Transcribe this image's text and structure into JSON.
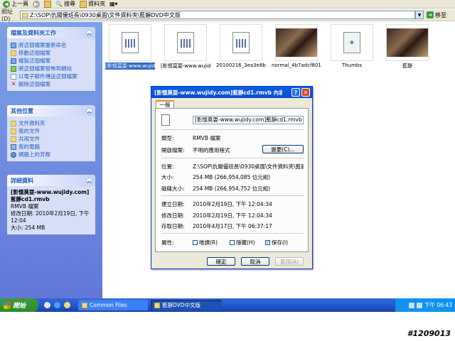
{
  "toolbar": {
    "back": "上一頁",
    "search": "搜尋",
    "folders": "資料夾"
  },
  "address": {
    "label": "網址(D)",
    "path": "Z:\\SOP\\仇關優班長\\0930桌面\\文件資料夾\\藍靜DVD中文版",
    "go": "移至"
  },
  "tasks": {
    "file_header": "檔案及資料夾工作",
    "file_items": [
      "將這個檔案重新命名",
      "移動這個檔案",
      "複製這個檔案",
      "將這個檔案發佈到網站",
      "以電子郵件傳送這個檔案",
      "刪除這個檔案"
    ],
    "places_header": "其他位置",
    "places_items": [
      "文件資料夾",
      "我的文件",
      "共用文件",
      "我的電腦",
      "網路上的芳鄰"
    ],
    "details_header": "詳細資料",
    "details_name": "[影憶莫耍-www.wujidy.com]藍靜cd1.rmvb",
    "details_type": "RMVB 檔案",
    "details_modified": "修改日期: 2010年2月19日, 下午 12:04",
    "details_size": "大小: 254 MB"
  },
  "files": [
    {
      "name": "[影憶莫耍-www.wujidy.com]...",
      "selected": true
    },
    {
      "name": "[影憶莫耍-www.wujidy.com]..."
    },
    {
      "name": "20100216_3ea3e8b5c..."
    },
    {
      "name": "normal_4b7adcf8011ba"
    },
    {
      "name": "Thumbs"
    },
    {
      "name": "藍靜"
    }
  ],
  "dialog": {
    "title": "[影憶莫耍-www.wujidy.com]藍靜cd1.rmvb 內容",
    "tab": "一般",
    "filename": "[影憶莫耍-www.wujidy.com]藍靜cd1.rmvb",
    "type_label": "類型:",
    "type_value": "RMVB 檔案",
    "open_label": "開啟檔案:",
    "open_value": "不明的應用程式",
    "change_button": "變更(C)...",
    "location_label": "位置:",
    "location_value": "Z:\\SOP\\仇關優班長\\0930桌面\\文件資料夾\\藍靜D",
    "size_label": "大小:",
    "size_value": "254 MB (266,954,085 位元組)",
    "disk_label": "磁碟大小:",
    "disk_value": "254 MB (266,954,752 位元組)",
    "created_label": "建立日期:",
    "created_value": "2010年2月19日, 下午 12:04:34",
    "modified_label": "修改日期:",
    "modified_value": "2010年2月19日, 下午 12:04:34",
    "accessed_label": "存取日期:",
    "accessed_value": "2010年4月17日, 下午 06:37:17",
    "attr_label": "屬性:",
    "readonly": "唯讀(R)",
    "hidden": "隱藏(H)",
    "archive": "保存(I)",
    "ok": "確定",
    "cancel": "取消",
    "apply": "套用(A)"
  },
  "taskbar": {
    "start": "開始",
    "task1": "Common Files",
    "task2": "藍靜DVD中文版",
    "clock": "下午 06:43"
  },
  "watermark": "#1209013"
}
